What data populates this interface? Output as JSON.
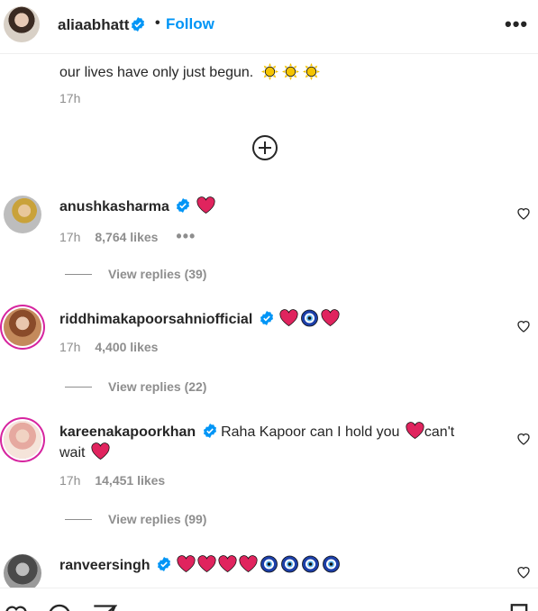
{
  "post": {
    "username": "aliaabhatt",
    "dot": "•",
    "follow_label": "Follow",
    "more_label": "•••",
    "caption_tail": "our lives have only just begun.",
    "caption_time": "17h"
  },
  "comments": [
    {
      "username": "anushkasharma",
      "text": "",
      "time": "17h",
      "likes": "8,764 likes",
      "more": "•••",
      "replies": "View replies (39)"
    },
    {
      "username": "riddhimakapoorsahniofficial",
      "text": "",
      "time": "17h",
      "likes": "4,400 likes",
      "replies": "View replies (22)"
    },
    {
      "username": "kareenakapoorkhan",
      "text_a": "Raha Kapoor can I hold you",
      "text_b": "can't",
      "text_c": "wait",
      "time": "17h",
      "likes": "14,451 likes",
      "replies": "View replies (99)"
    },
    {
      "username": "ranveersingh",
      "text": ""
    }
  ],
  "colors": {
    "accent": "#0095f6",
    "verified": "#0095f6",
    "story_ring": "#d6249f",
    "heart": "#e0245e"
  }
}
